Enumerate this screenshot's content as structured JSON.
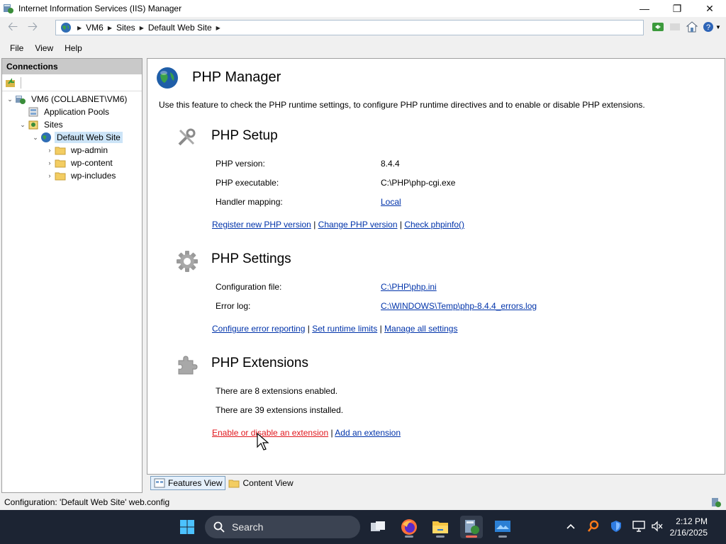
{
  "window": {
    "title": "Internet Information Services (IIS) Manager"
  },
  "address": {
    "crumbs": [
      "VM6",
      "Sites",
      "Default Web Site"
    ]
  },
  "menu": {
    "items": [
      "File",
      "View",
      "Help"
    ]
  },
  "connections": {
    "header": "Connections",
    "tree": {
      "server": "VM6 (COLLABNET\\VM6)",
      "app_pools": "Application Pools",
      "sites": "Sites",
      "default_site": "Default Web Site",
      "folders": [
        "wp-admin",
        "wp-content",
        "wp-includes"
      ]
    }
  },
  "main": {
    "title": "PHP Manager",
    "description": "Use this feature to check the PHP runtime settings, to configure PHP runtime directives and to enable or disable PHP extensions.",
    "setup": {
      "heading": "PHP Setup",
      "version_label": "PHP version:",
      "version_value": "8.4.4",
      "exe_label": "PHP executable:",
      "exe_value": "C:\\PHP\\php-cgi.exe",
      "handler_label": "Handler mapping:",
      "handler_value": "Local",
      "links": [
        "Register new PHP version",
        "Change PHP version",
        "Check phpinfo()"
      ]
    },
    "settings": {
      "heading": "PHP Settings",
      "config_label": "Configuration file:",
      "config_value": "C:\\PHP\\php.ini",
      "errorlog_label": "Error log:",
      "errorlog_value": "C:\\WINDOWS\\Temp\\php-8.4.4_errors.log",
      "links": [
        "Configure error reporting",
        "Set runtime limits",
        "Manage all settings"
      ]
    },
    "extensions": {
      "heading": "PHP Extensions",
      "enabled_text": "There are 8 extensions enabled.",
      "installed_text": "There are 39 extensions installed.",
      "links": [
        "Enable or disable an extension",
        "Add an extension"
      ]
    },
    "link_separator": "|"
  },
  "view_tabs": {
    "features": "Features View",
    "content": "Content View"
  },
  "status": {
    "text": "Configuration: 'Default Web Site' web.config"
  },
  "taskbar": {
    "search_placeholder": "Search",
    "time": "2:12 PM",
    "date": "2/16/2025"
  },
  "colors": {
    "link": "#0033aa",
    "link_hover": "#e0161c",
    "taskbar": "#1c2433",
    "selection": "#cce4f7"
  }
}
